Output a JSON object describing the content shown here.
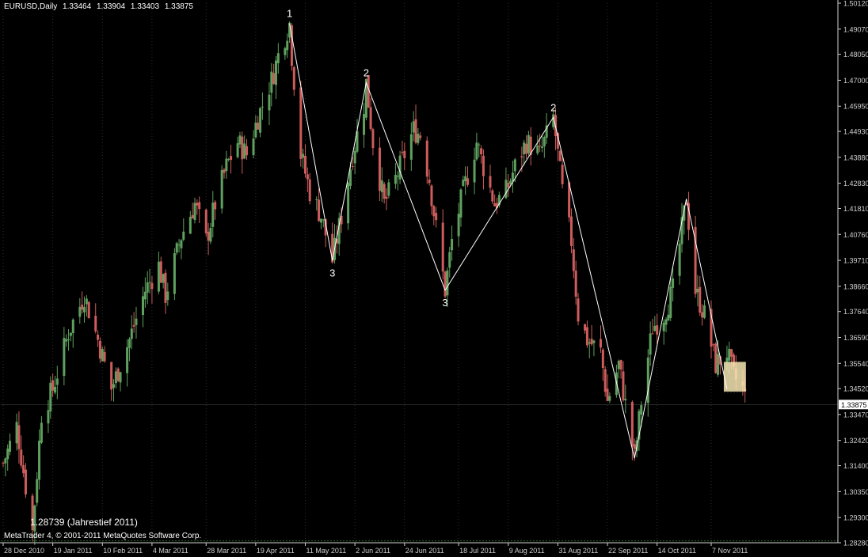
{
  "header": {
    "symbol": "EURUSD,Daily",
    "open": "1.33464",
    "high": "1.33904",
    "low": "1.33403",
    "close": "1.33875"
  },
  "footer": {
    "copyright": "MetaTrader 4, © 2001-2011 MetaQuotes Software Corp."
  },
  "annotation": {
    "text": "1.28739 (Jahrestief 2011)"
  },
  "colors": {
    "background": "#000000",
    "grid": "#2e2e2e",
    "axis": "#cfcfcf",
    "bull": "#5fa05f",
    "bear": "#cd5c5c",
    "zigzag": "#ffffff",
    "highlight": "#f5e6b3",
    "price_tag": "#ffffff",
    "low_line": "#2f6b2f"
  },
  "chart_data": {
    "type": "candlestick",
    "current_price": "1.33875",
    "y_ticks": [
      "1.50120",
      "1.49070",
      "1.48050",
      "1.47000",
      "1.45950",
      "1.44930",
      "1.43880",
      "1.42830",
      "1.41810",
      "1.40760",
      "1.39710",
      "1.38660",
      "1.37640",
      "1.36590",
      "1.35540",
      "1.34520",
      "1.33470",
      "1.32420",
      "1.31400",
      "1.30350",
      "1.29300",
      "1.28280"
    ],
    "x_ticks": [
      {
        "label": "28 Dec 2010",
        "date": "2010-12-28"
      },
      {
        "label": "19 Jan 2011",
        "date": "2011-01-19"
      },
      {
        "label": "10 Feb 2011",
        "date": "2011-02-10"
      },
      {
        "label": "4 Mar 2011",
        "date": "2011-03-04"
      },
      {
        "label": "28 Mar 2011",
        "date": "2011-03-28"
      },
      {
        "label": "19 Apr 2011",
        "date": "2011-04-19"
      },
      {
        "label": "11 May 2011",
        "date": "2011-05-11"
      },
      {
        "label": "2 Jun 2011",
        "date": "2011-06-02"
      },
      {
        "label": "24 Jun 2011",
        "date": "2011-06-24"
      },
      {
        "label": "18 Jul 2011",
        "date": "2011-07-18"
      },
      {
        "label": "9 Aug 2011",
        "date": "2011-08-09"
      },
      {
        "label": "31 Aug 2011",
        "date": "2011-08-31"
      },
      {
        "label": "22 Sep 2011",
        "date": "2011-09-22"
      },
      {
        "label": "14 Oct 2011",
        "date": "2011-10-14"
      },
      {
        "label": "7 Nov 2011",
        "date": "2011-11-07"
      }
    ],
    "price_path": [
      {
        "date": "2010-12-28",
        "close": 1.315
      },
      {
        "date": "2011-01-03",
        "close": 1.33
      },
      {
        "date": "2011-01-10",
        "close": 1.2874
      },
      {
        "date": "2011-01-14",
        "close": 1.335
      },
      {
        "date": "2011-01-19",
        "close": 1.345
      },
      {
        "date": "2011-01-26",
        "close": 1.368
      },
      {
        "date": "2011-02-02",
        "close": 1.383
      },
      {
        "date": "2011-02-08",
        "close": 1.365
      },
      {
        "date": "2011-02-14",
        "close": 1.345
      },
      {
        "date": "2011-02-22",
        "close": 1.365
      },
      {
        "date": "2011-03-01",
        "close": 1.385
      },
      {
        "date": "2011-03-07",
        "close": 1.395
      },
      {
        "date": "2011-03-10",
        "close": 1.383
      },
      {
        "date": "2011-03-17",
        "close": 1.407
      },
      {
        "date": "2011-03-23",
        "close": 1.42
      },
      {
        "date": "2011-03-28",
        "close": 1.405
      },
      {
        "date": "2011-04-01",
        "close": 1.42
      },
      {
        "date": "2011-04-06",
        "close": 1.435
      },
      {
        "date": "2011-04-11",
        "close": 1.445
      },
      {
        "date": "2011-04-15",
        "close": 1.44
      },
      {
        "date": "2011-04-20",
        "close": 1.455
      },
      {
        "date": "2011-04-26",
        "close": 1.47
      },
      {
        "date": "2011-04-29",
        "close": 1.48
      },
      {
        "date": "2011-05-04",
        "close": 1.493
      },
      {
        "date": "2011-05-05",
        "close": 1.48
      },
      {
        "date": "2011-05-09",
        "close": 1.44
      },
      {
        "date": "2011-05-13",
        "close": 1.425
      },
      {
        "date": "2011-05-18",
        "close": 1.415
      },
      {
        "date": "2011-05-23",
        "close": 1.397
      },
      {
        "date": "2011-05-27",
        "close": 1.415
      },
      {
        "date": "2011-06-01",
        "close": 1.44
      },
      {
        "date": "2011-06-06",
        "close": 1.46
      },
      {
        "date": "2011-06-07",
        "close": 1.469
      },
      {
        "date": "2011-06-10",
        "close": 1.445
      },
      {
        "date": "2011-06-15",
        "close": 1.42
      },
      {
        "date": "2011-06-20",
        "close": 1.43
      },
      {
        "date": "2011-06-24",
        "close": 1.44
      },
      {
        "date": "2011-06-28",
        "close": 1.45
      },
      {
        "date": "2011-07-01",
        "close": 1.448
      },
      {
        "date": "2011-07-05",
        "close": 1.43
      },
      {
        "date": "2011-07-08",
        "close": 1.41
      },
      {
        "date": "2011-07-12",
        "close": 1.385
      },
      {
        "date": "2011-07-15",
        "close": 1.405
      },
      {
        "date": "2011-07-20",
        "close": 1.425
      },
      {
        "date": "2011-07-26",
        "close": 1.445
      },
      {
        "date": "2011-07-29",
        "close": 1.435
      },
      {
        "date": "2011-08-03",
        "close": 1.42
      },
      {
        "date": "2011-08-08",
        "close": 1.425
      },
      {
        "date": "2011-08-12",
        "close": 1.435
      },
      {
        "date": "2011-08-17",
        "close": 1.445
      },
      {
        "date": "2011-08-23",
        "close": 1.44
      },
      {
        "date": "2011-08-29",
        "close": 1.455
      },
      {
        "date": "2011-09-02",
        "close": 1.425
      },
      {
        "date": "2011-09-06",
        "close": 1.405
      },
      {
        "date": "2011-09-09",
        "close": 1.375
      },
      {
        "date": "2011-09-13",
        "close": 1.365
      },
      {
        "date": "2011-09-19",
        "close": 1.36
      },
      {
        "date": "2011-09-22",
        "close": 1.34
      },
      {
        "date": "2011-09-27",
        "close": 1.355
      },
      {
        "date": "2011-10-04",
        "close": 1.317
      },
      {
        "date": "2011-10-07",
        "close": 1.34
      },
      {
        "date": "2011-10-12",
        "close": 1.37
      },
      {
        "date": "2011-10-17",
        "close": 1.375
      },
      {
        "date": "2011-10-21",
        "close": 1.385
      },
      {
        "date": "2011-10-27",
        "close": 1.422
      },
      {
        "date": "2011-10-31",
        "close": 1.385
      },
      {
        "date": "2011-11-04",
        "close": 1.375
      },
      {
        "date": "2011-11-09",
        "close": 1.355
      },
      {
        "date": "2011-11-14",
        "close": 1.36
      },
      {
        "date": "2011-11-17",
        "close": 1.35
      },
      {
        "date": "2011-11-21",
        "close": 1.345
      },
      {
        "date": "2011-11-23",
        "close": 1.3388
      }
    ],
    "zigzag": [
      {
        "date": "2011-05-04",
        "price": 1.493,
        "label": "1",
        "pos": "above"
      },
      {
        "date": "2011-05-23",
        "price": 1.397,
        "label": "3",
        "pos": "below"
      },
      {
        "date": "2011-06-07",
        "price": 1.469,
        "label": "2",
        "pos": "above"
      },
      {
        "date": "2011-07-12",
        "price": 1.385,
        "label": "3",
        "pos": "below"
      },
      {
        "date": "2011-08-29",
        "price": 1.455,
        "label": "2",
        "pos": "above"
      },
      {
        "date": "2011-10-04",
        "price": 1.317,
        "label": "",
        "pos": "below"
      },
      {
        "date": "2011-10-27",
        "price": 1.422,
        "label": "",
        "pos": "above"
      },
      {
        "date": "2011-11-14",
        "price": 1.345,
        "label": "",
        "pos": "below"
      }
    ],
    "highlight": {
      "from": "2011-11-14",
      "to": "2011-11-21",
      "low": 1.344,
      "high": 1.356
    },
    "year_low": 1.2874
  }
}
